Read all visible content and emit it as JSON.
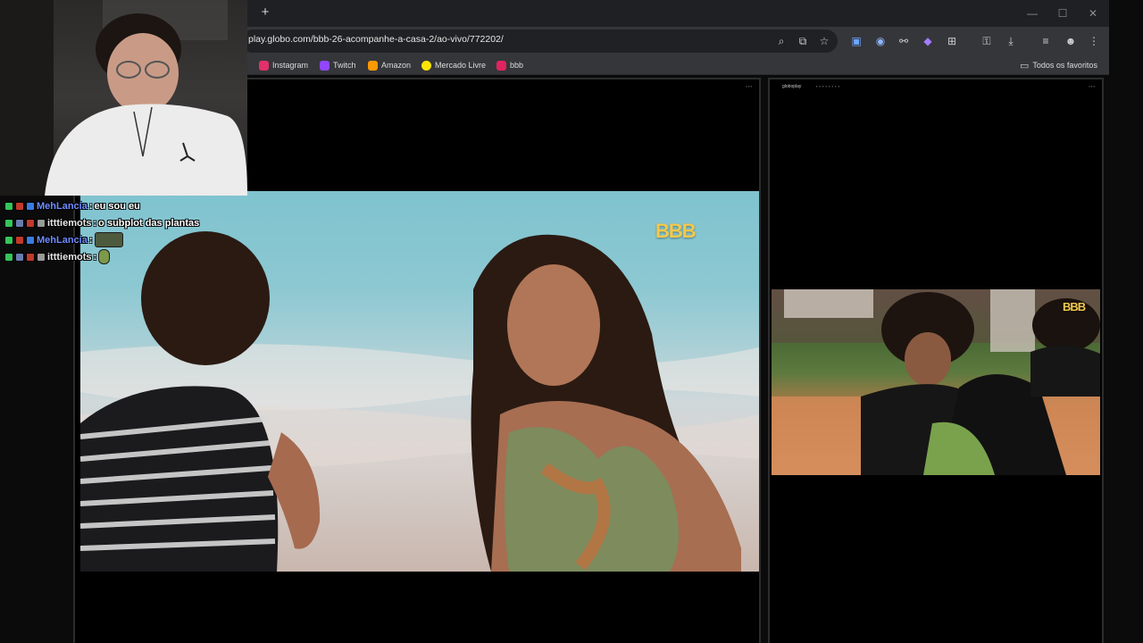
{
  "browser": {
    "url": "play.globo.com/bbb-26-acompanhe-a-casa-2/ao-vivo/772202/",
    "new_tab_icon": "plus-icon",
    "window_controls": [
      "minimize-icon",
      "maximize-icon",
      "close-icon"
    ],
    "omnibox_icons": [
      "zoom-icon",
      "install-icon",
      "star-icon"
    ],
    "toolbar_icons": [
      "translate-extension-icon",
      "circle-extension-icon",
      "glasses-extension-icon",
      "purple-extension-icon",
      "puzzle-extensions-icon",
      "password-icon",
      "download-icon",
      "media-queue-icon",
      "profile-icon",
      "kebab-menu-icon"
    ],
    "bookmarks": [
      {
        "label": "Instagram",
        "color": "#e1306c"
      },
      {
        "label": "Twitch",
        "color": "#9146ff"
      },
      {
        "label": "Amazon",
        "color": "#ff9900"
      },
      {
        "label": "Mercado Livre",
        "color": "#ffe600"
      },
      {
        "label": "bbb",
        "color": "#e0245e"
      }
    ],
    "all_bookmarks_label": "Todos os favoritos"
  },
  "players": {
    "main_logo": "BBB",
    "side_logo": "BBB",
    "side_site_label": "globoplay"
  },
  "chat": {
    "messages": [
      {
        "user": "MehLancia",
        "text": "eu sou eu",
        "user_color": "#6f8cff"
      },
      {
        "user": "itttiemots",
        "text": "o subplot das plantas",
        "user_color": "#e6e6e6"
      },
      {
        "user": "MehLancia",
        "text": "",
        "emote": "frog-emote",
        "user_color": "#6f8cff"
      },
      {
        "user": "itttiemots",
        "text": "",
        "emote": "pickle-emote",
        "user_color": "#e6e6e6"
      }
    ]
  }
}
